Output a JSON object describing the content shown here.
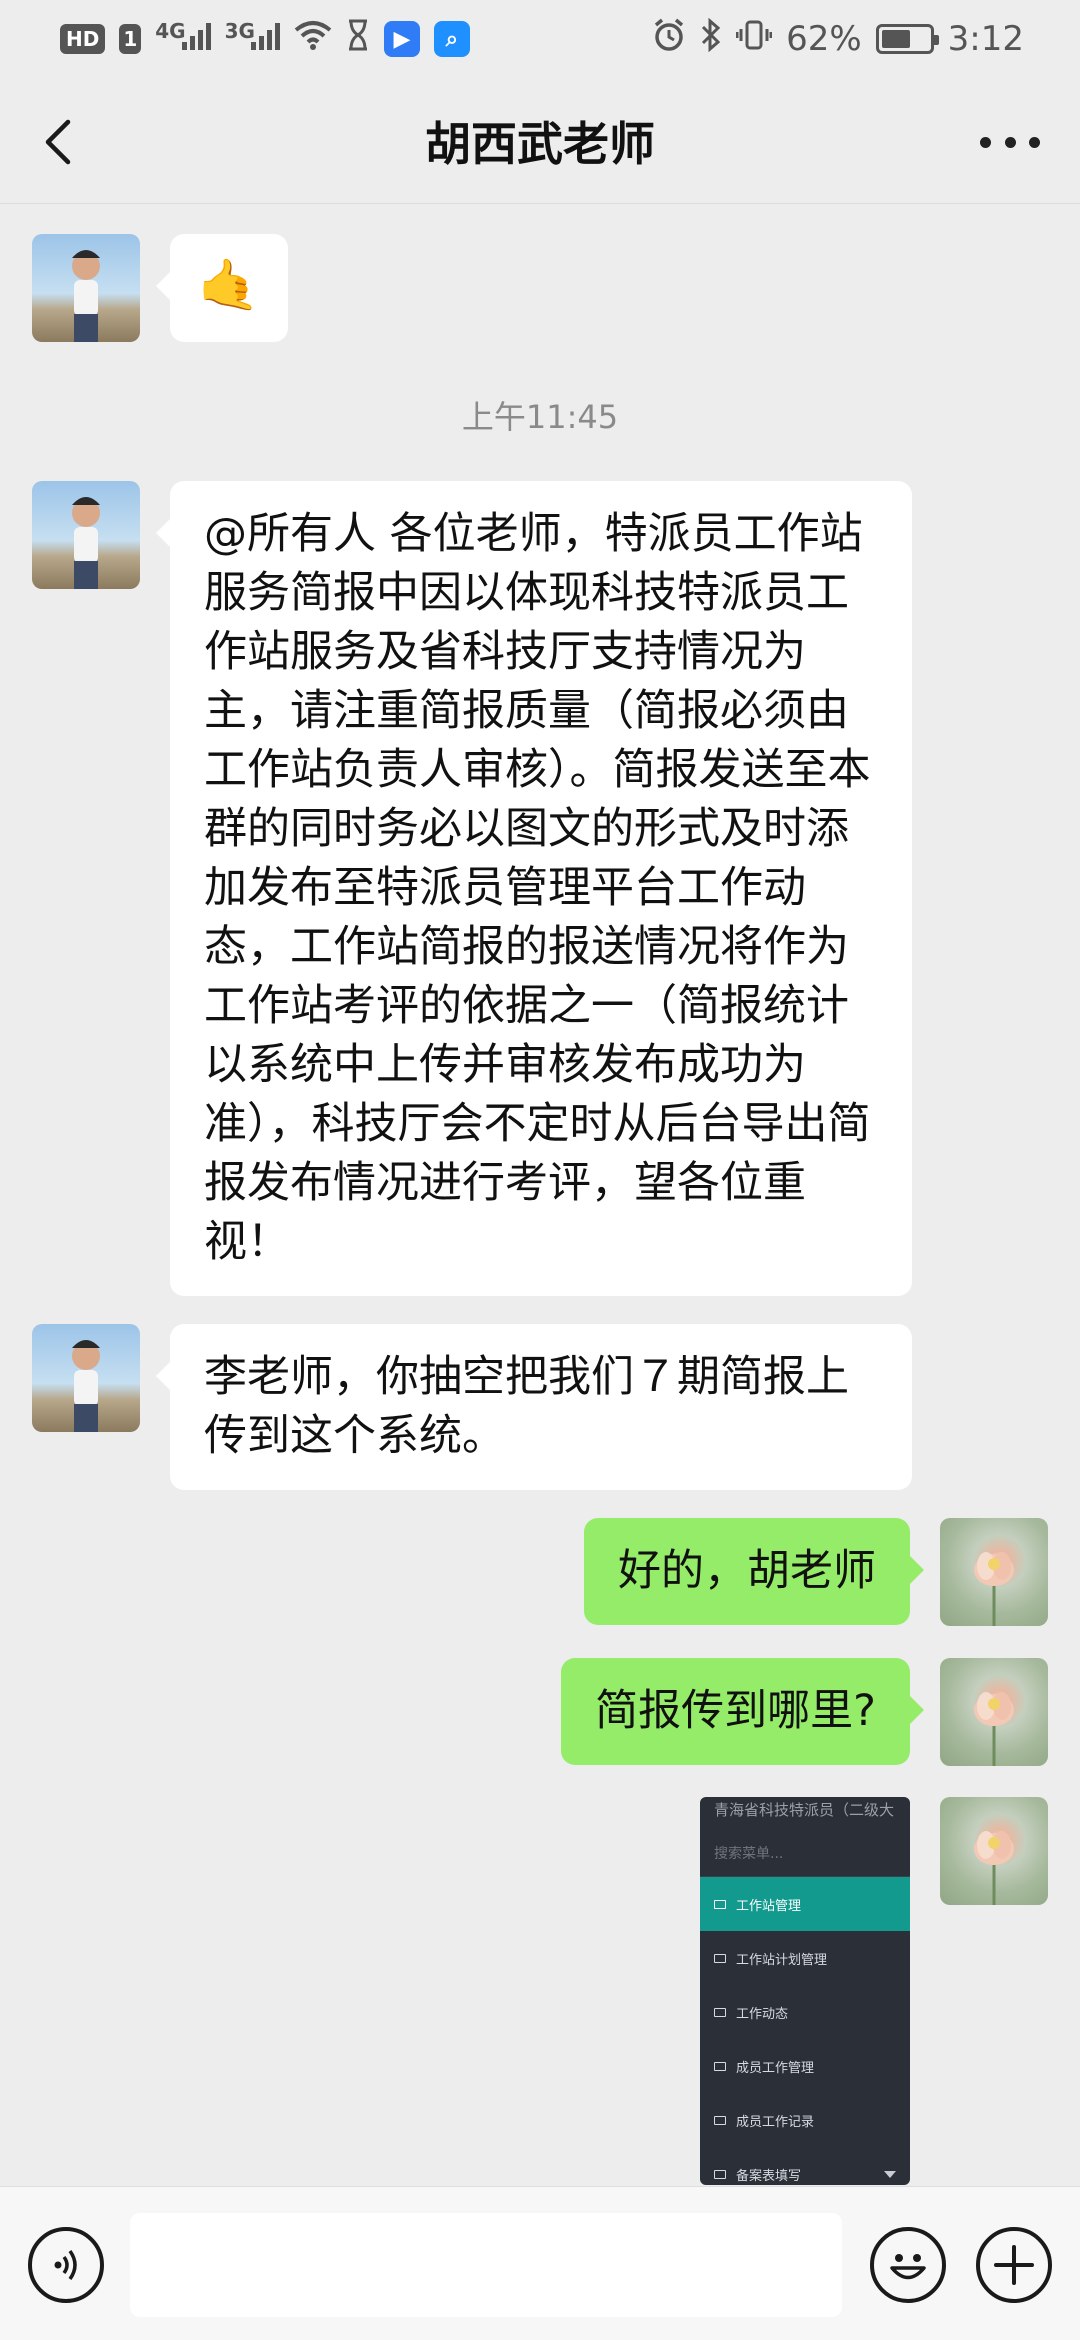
{
  "status_bar": {
    "hd": "HD",
    "sim1": "1",
    "net1": "4G",
    "net2": "3G",
    "battery": "62%",
    "battery_level": 0.62,
    "time": "3:12"
  },
  "header": {
    "title": "胡西武老师"
  },
  "messages": [
    {
      "side": "in",
      "type": "emoji",
      "text": "🤙"
    },
    {
      "side": "in",
      "type": "text",
      "text": "@所有人  各位老师，特派员工作站服务简报中因以体现科技特派员工作站服务及省科技厅支持情况为主，请注重简报质量（简报必须由工作站负责人审核）。简报发送至本群的同时务必以图文的形式及时添加发布至特派员管理平台工作动态，工作站简报的报送情况将作为工作站考评的依据之一（简报统计以系统中上传并审核发布成功为准），科技厅会不定时从后台导出简报发布情况进行考评，望各位重视！"
    },
    {
      "side": "in",
      "type": "text",
      "text": "李老师，你抽空把我们７期简报上传到这个系统。"
    },
    {
      "side": "out",
      "type": "text",
      "text": "好的，胡老师"
    },
    {
      "side": "out",
      "type": "text",
      "text": "简报传到哪里?"
    },
    {
      "side": "out",
      "type": "image"
    }
  ],
  "time_divider": "上午11:45",
  "shared_screenshot": {
    "header_text": "青海省科技特派员（二级大",
    "search_placeholder": "搜索菜单...",
    "menu": [
      {
        "label": "工作站管理",
        "active": true
      },
      {
        "label": "工作站计划管理",
        "active": false
      },
      {
        "label": "工作动态",
        "active": false
      },
      {
        "label": "成员工作管理",
        "active": false
      },
      {
        "label": "成员工作记录",
        "active": false
      },
      {
        "label": "备案表填写",
        "active": false
      }
    ]
  },
  "input_bar": {
    "placeholder": "",
    "voice_icon": "voice-icon",
    "emoji_icon": "emoji-icon",
    "plus_icon": "plus-icon"
  },
  "colors": {
    "outgoing_bubble": "#95ec69",
    "incoming_bubble": "#ffffff",
    "background": "#ededed",
    "menu_active": "#129a8e"
  }
}
